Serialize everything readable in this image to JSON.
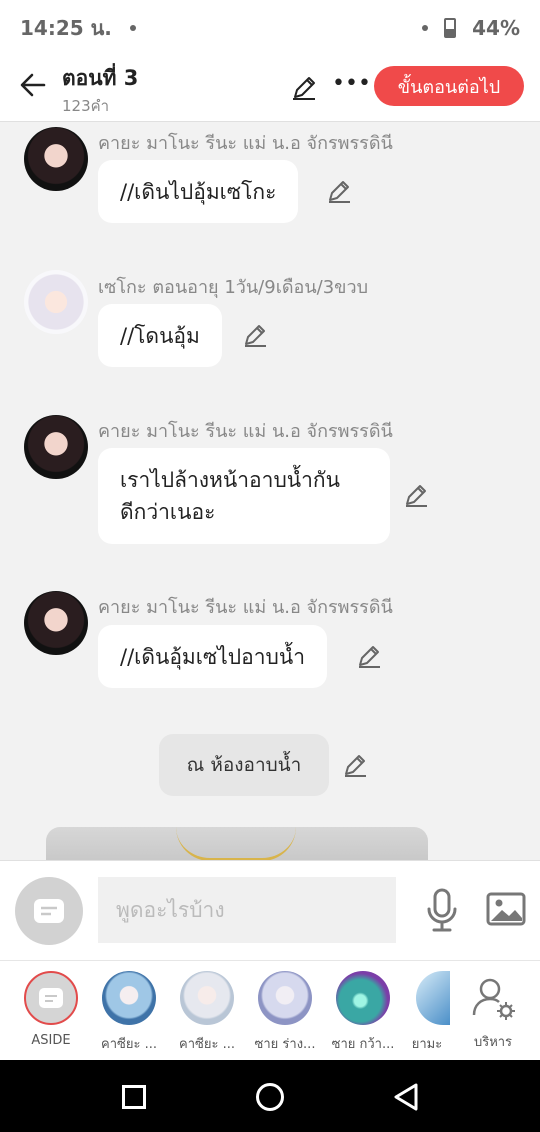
{
  "status": {
    "time": "14:25 น.",
    "battery": "44%"
  },
  "header": {
    "title": "ตอนที่ 3",
    "subtitle": "123คำ",
    "next_label": "ขั้นตอนต่อไป"
  },
  "messages": [
    {
      "speaker": "คายะ มาโนะ รีนะ แม่ น.อ จักรพรรดินี",
      "text": "//เดินไปอุ้มเซโกะ"
    },
    {
      "speaker": "เซโกะ ตอนอายุ 1วัน/9เดือน/3ขวบ",
      "text": "//โดนอุ้ม"
    },
    {
      "speaker": "คายะ มาโนะ รีนะ แม่ น.อ จักรพรรดินี",
      "text_line1": "เราไปล้างหน้าอาบน้ำกัน",
      "text_line2": "ดีกว่าเนอะ"
    },
    {
      "speaker": "คายะ มาโนะ รีนะ แม่ น.อ จักรพรรดินี",
      "text": "//เดินอุ้มเซไปอาบน้ำ"
    }
  ],
  "narration": "ณ ห้องอาบน้ำ",
  "input": {
    "placeholder": "พูดอะไรบ้าง"
  },
  "characters": [
    {
      "label": "ASIDE"
    },
    {
      "label": "คาซียะ ..."
    },
    {
      "label": "คาซียะ ..."
    },
    {
      "label": "ซาย ร่าง..."
    },
    {
      "label": "ซาย กว้า..."
    },
    {
      "label": "ยามะ"
    },
    {
      "label": "บริหาร"
    }
  ],
  "colors": {
    "accent": "#f04a4a",
    "bubble": "#ffffff",
    "background": "#f2f2f2"
  }
}
